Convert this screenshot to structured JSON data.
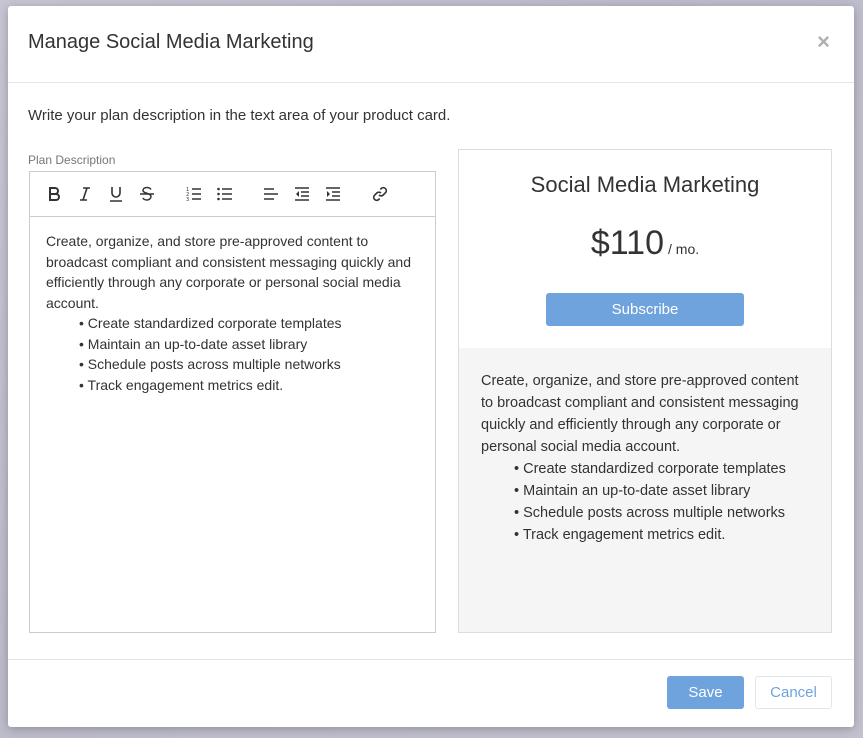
{
  "modal": {
    "title": "Manage Social Media Marketing",
    "close_label": "×",
    "intro": "Write your plan description in the text area of your product card."
  },
  "editor": {
    "label": "Plan Description",
    "toolbar": [
      "bold-icon",
      "italic-icon",
      "underline-icon",
      "strikethrough-icon",
      "ordered-list-icon",
      "bullet-list-icon",
      "align-left-icon",
      "outdent-icon",
      "indent-icon",
      "link-icon"
    ],
    "paragraph": "Create, organize, and store pre-approved content to broadcast compliant and consistent messaging quickly and efficiently through any corporate or personal social media account.",
    "bullets": [
      "Create standardized corporate templates",
      "Maintain an up-to-date asset library",
      "Schedule posts across multiple networks",
      "Track engagement metrics edit."
    ]
  },
  "card": {
    "title": "Social Media Marketing",
    "price": "$110",
    "period": "/ mo.",
    "subscribe_label": "Subscribe",
    "paragraph": "Create, organize, and store pre-approved content to broadcast compliant and consistent messaging quickly and efficiently through any corporate or personal social media account.",
    "bullets": [
      "Create standardized corporate templates",
      "Maintain an up-to-date asset library",
      "Schedule posts across multiple networks",
      "Track engagement metrics edit."
    ]
  },
  "footer": {
    "save_label": "Save",
    "cancel_label": "Cancel"
  },
  "colors": {
    "accent": "#6fa3dd",
    "card_bottom": "#f5f5f5"
  }
}
